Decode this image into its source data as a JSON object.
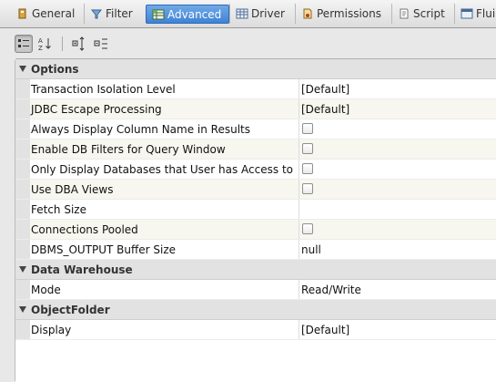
{
  "tabs": [
    {
      "label": "General",
      "icon": "general-icon"
    },
    {
      "label": "Filter",
      "icon": "filter-icon"
    },
    {
      "label": "Advanced",
      "icon": "advanced-icon",
      "active": true
    },
    {
      "label": "Driver",
      "icon": "driver-icon"
    },
    {
      "label": "Permissions",
      "icon": "permissions-icon"
    },
    {
      "label": "Script",
      "icon": "script-icon"
    },
    {
      "label": "Flui",
      "icon": "flui-icon"
    }
  ],
  "toolbar": {
    "buttons": [
      "categorized-view-icon",
      "sort-alphabetical-icon",
      "expand-all-icon",
      "collapse-all-icon"
    ]
  },
  "sections": [
    {
      "title": "Options",
      "properties": [
        {
          "name": "Transaction Isolation Level",
          "value": "[Default]"
        },
        {
          "name": "JDBC Escape Processing",
          "value": "[Default]"
        },
        {
          "name": "Always Display Column Name in Results",
          "checkbox": true
        },
        {
          "name": "Enable DB Filters for Query Window",
          "checkbox": true
        },
        {
          "name": "Only Display Databases that User has Access to",
          "checkbox": true
        },
        {
          "name": "Use DBA Views",
          "checkbox": true
        },
        {
          "name": "Fetch Size",
          "value": ""
        },
        {
          "name": "Connections Pooled",
          "checkbox": true
        },
        {
          "name": "DBMS_OUTPUT Buffer Size",
          "value": "null"
        }
      ]
    },
    {
      "title": "Data Warehouse",
      "properties": [
        {
          "name": "Mode",
          "value": "Read/Write"
        }
      ]
    },
    {
      "title": "ObjectFolder",
      "properties": [
        {
          "name": "Display",
          "value": "[Default]"
        }
      ]
    }
  ]
}
